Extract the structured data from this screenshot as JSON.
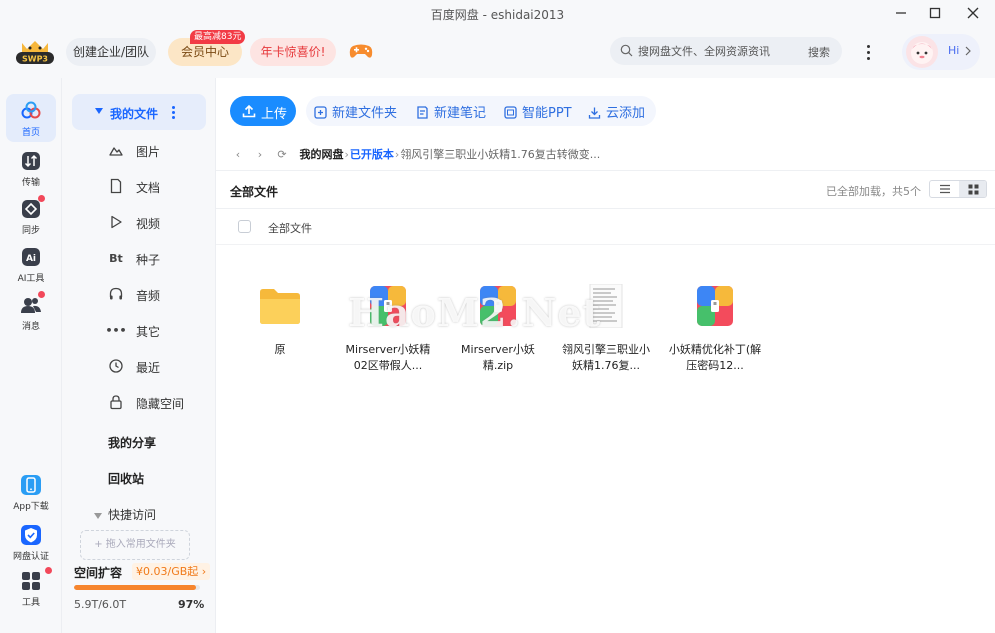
{
  "window": {
    "title": "百度网盘 - eshidai2013"
  },
  "header": {
    "logo_text": "SWP3",
    "enterprise_label": "创建企业/团队",
    "vip_label": "会员中心",
    "vip_badge": "最高减83元",
    "year_card_label": "年卡惊喜价!",
    "search": {
      "placeholder": "搜网盘文件、全网资源资讯",
      "button_label": "搜索"
    },
    "user_greeting": "Hi"
  },
  "rail": {
    "items": [
      {
        "label": "首页",
        "icon": "cloud-icon",
        "active": true
      },
      {
        "label": "传输",
        "icon": "transfer-icon"
      },
      {
        "label": "同步",
        "icon": "sync-icon",
        "badge": true
      },
      {
        "label": "AI工具",
        "icon": "ai-icon"
      },
      {
        "label": "消息",
        "icon": "message-icon",
        "badge": true
      }
    ],
    "bottom_items": [
      {
        "label": "App下载",
        "icon": "phone-icon"
      },
      {
        "label": "网盘认证",
        "icon": "verify-icon"
      },
      {
        "label": "工具",
        "icon": "tools-icon",
        "badge": true
      }
    ]
  },
  "sidebar": {
    "my_files": "我的文件",
    "categories": [
      {
        "label": "图片",
        "icon": "image-icon"
      },
      {
        "label": "文档",
        "icon": "document-icon"
      },
      {
        "label": "视频",
        "icon": "video-icon"
      },
      {
        "label": "种子",
        "icon": "torrent-icon",
        "glyph": "Bt"
      },
      {
        "label": "音频",
        "icon": "audio-icon"
      },
      {
        "label": "其它",
        "icon": "other-icon",
        "glyph": "•••"
      },
      {
        "label": "最近",
        "icon": "recent-icon"
      },
      {
        "label": "隐藏空间",
        "icon": "lock-icon"
      }
    ],
    "my_share": "我的分享",
    "recycle_bin": "回收站",
    "quick_access": "快捷访问",
    "add_quick": "+ 拖入常用文件夹",
    "storage": {
      "label": "空间扩容",
      "promo": "¥0.03/GB起 ›",
      "used": "5.9T/6.0T",
      "percent_label": "97%",
      "percent": 0.97
    }
  },
  "toolbar": {
    "upload": "上传",
    "new_folder": "新建文件夹",
    "new_note": "新建笔记",
    "smart_ppt": "智能PPT",
    "cloud_add": "云添加"
  },
  "breadcrumb": {
    "root": "我的网盘",
    "level1": "已开版本",
    "level2": "翎风引擎三职业小妖精1.76复古转微变..."
  },
  "list": {
    "title": "全部文件",
    "load_info": "已全部加载，共5个",
    "column_header": "全部文件",
    "files": [
      {
        "name": "原",
        "type": "folder"
      },
      {
        "name": "Mirserver小妖精02区带假人...",
        "type": "archive"
      },
      {
        "name": "Mirserver小妖精.zip",
        "type": "archive"
      },
      {
        "name": "翎风引擎三职业小妖精1.76复...",
        "type": "document"
      },
      {
        "name": "小妖精优化补丁(解压密码12...",
        "type": "archive"
      }
    ]
  },
  "watermark": "HaoM2.Net",
  "colors": {
    "accent": "#1a66ff",
    "upload_button": "#1a8cff",
    "storage_fill": "#f6852e",
    "badge_red": "#f2485a"
  }
}
